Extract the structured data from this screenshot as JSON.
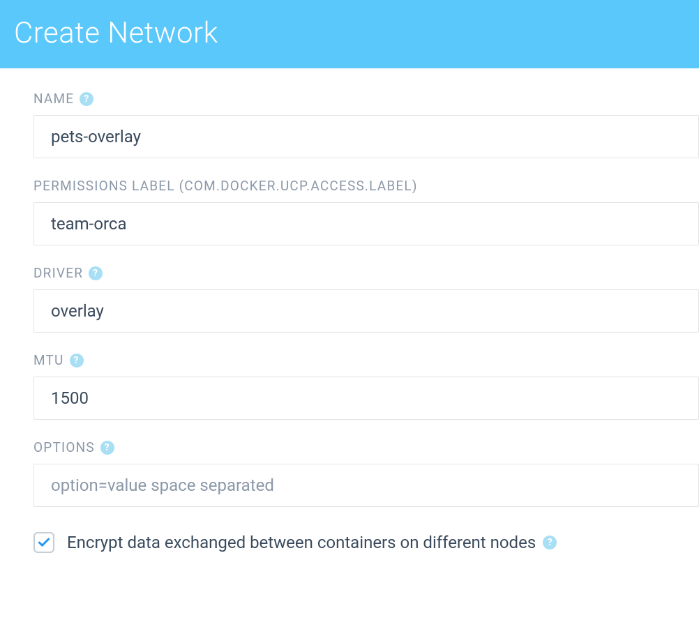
{
  "header": {
    "title": "Create Network"
  },
  "form": {
    "name": {
      "label": "NAME",
      "value": "pets-overlay"
    },
    "permissions": {
      "label": "PERMISSIONS LABEL (COM.DOCKER.UCP.ACCESS.LABEL)",
      "value": "team-orca"
    },
    "driver": {
      "label": "DRIVER",
      "value": "overlay"
    },
    "mtu": {
      "label": "MTU",
      "value": "1500"
    },
    "options": {
      "label": "OPTIONS",
      "placeholder": "option=value space separated",
      "value": ""
    },
    "encrypt": {
      "label": "Encrypt data exchanged between containers on different nodes",
      "checked": true
    }
  }
}
